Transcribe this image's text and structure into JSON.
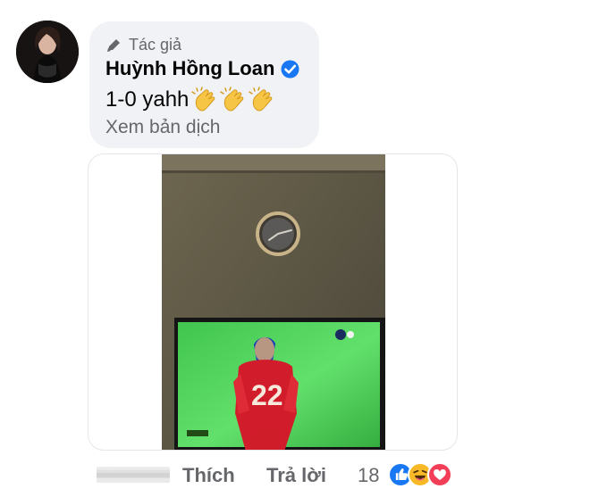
{
  "comment": {
    "badge": "Tác giả",
    "author": "Huỳnh Hồng Loan",
    "text": "1-0 yahh",
    "see_translation": "Xem bản dịch",
    "emojis": [
      "clapping-hands-icon",
      "clapping-hands-icon",
      "clapping-hands-icon"
    ]
  },
  "actions": {
    "like": "Thích",
    "reply": "Trả lời",
    "reaction_count": "18",
    "reactions": [
      "like-reaction-icon",
      "haha-reaction-icon",
      "love-reaction-icon"
    ]
  },
  "photo": {
    "jersey_number": "22"
  },
  "colors": {
    "bubble": "#f0f2f5",
    "secondary_text": "#65676b",
    "verified": "#1877f2",
    "like": "#1877f2",
    "haha": "#f7b928",
    "love": "#f33e58"
  }
}
